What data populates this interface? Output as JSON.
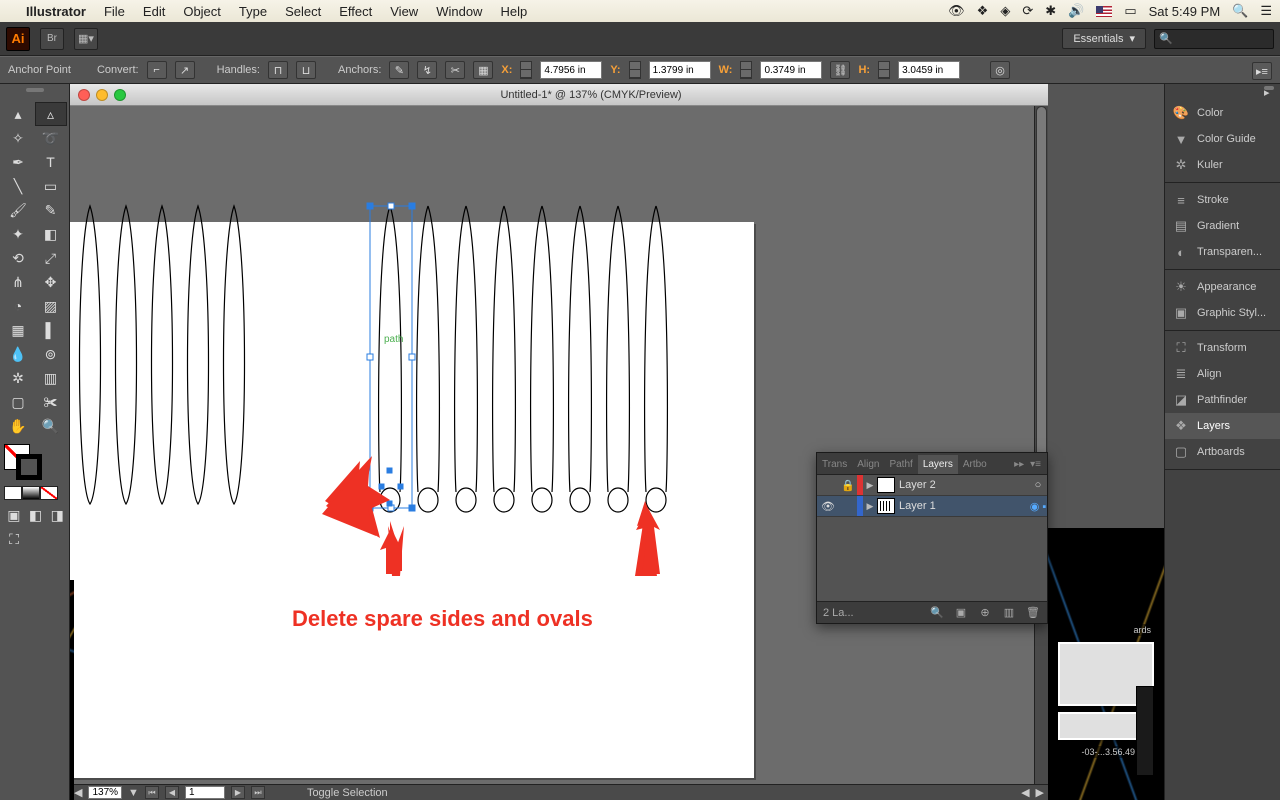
{
  "menubar": {
    "app": "Illustrator",
    "items": [
      "File",
      "Edit",
      "Object",
      "Type",
      "Select",
      "Effect",
      "View",
      "Window",
      "Help"
    ],
    "clock": "Sat 5:49 PM"
  },
  "apptop": {
    "workspace": "Essentials"
  },
  "ctrl": {
    "mode": "Anchor Point",
    "convert": "Convert:",
    "handles": "Handles:",
    "anchors": "Anchors:",
    "x_label": "X:",
    "x": "4.7956 in",
    "y_label": "Y:",
    "y": "1.3799 in",
    "w_label": "W:",
    "w": "0.3749 in",
    "h_label": "H:",
    "h": "3.0459 in"
  },
  "doc": {
    "title": "Untitled-1* @ 137% (CMYK/Preview)",
    "sel_label": "path"
  },
  "annotation": "Delete spare sides and ovals",
  "status": {
    "zoom": "137%",
    "page": "1",
    "hint": "Toggle Selection"
  },
  "panels": {
    "group1": [
      "Color",
      "Color Guide",
      "Kuler"
    ],
    "group2": [
      "Stroke",
      "Gradient",
      "Transparen..."
    ],
    "group3": [
      "Appearance",
      "Graphic Styl..."
    ],
    "group4": [
      "Transform",
      "Align",
      "Pathfinder",
      "Layers",
      "Artboards"
    ]
  },
  "layers": {
    "tabs": [
      "Trans",
      "Align",
      "Pathf",
      "Layers",
      "Artbo"
    ],
    "rows": [
      {
        "name": "Layer 2",
        "color": "#d33"
      },
      {
        "name": "Layer 1",
        "color": "#36c"
      }
    ],
    "count": "2 La..."
  },
  "bg": {
    "stack_label": "ards",
    "time_label": "-03-...3.56.49 PM"
  }
}
